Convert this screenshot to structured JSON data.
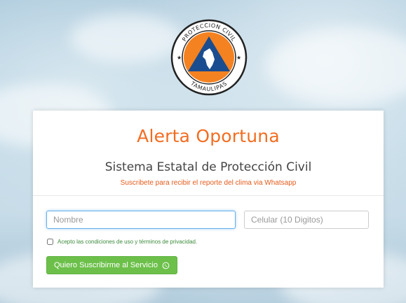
{
  "logo": {
    "top_text": "PROTECCION CIVIL",
    "bottom_text": "TAMAULIPAS"
  },
  "form": {
    "title": "Alerta Oportuna",
    "subtitle": "Sistema Estatal de Protección Civil",
    "tagline": "Suscribete para recibir el reporte del clima via Whatsapp",
    "name_placeholder": "Nombre",
    "name_value": "",
    "phone_placeholder": "Celular (10 Digitos)",
    "phone_value": "",
    "terms_label": "Acepto las condiciones de uso y términos de privacidad.",
    "terms_checked": false,
    "submit_label": "Quiero Suscribirme al Servicio",
    "submit_icon": "whatsapp-icon"
  },
  "colors": {
    "accent": "#f26d21",
    "button": "#6cc04a",
    "terms_text": "#3b8a3b"
  }
}
